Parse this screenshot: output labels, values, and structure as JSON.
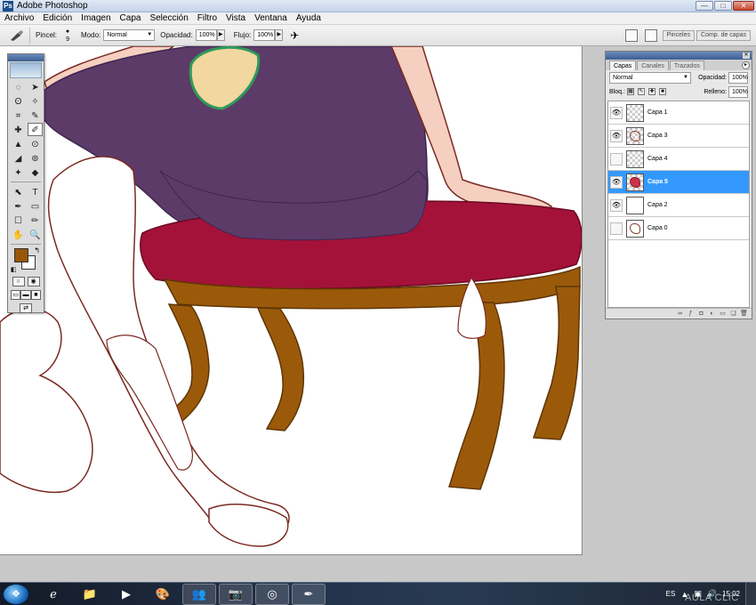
{
  "window": {
    "title": "Adobe Photoshop",
    "app_icon": "Ps"
  },
  "window_controls": {
    "minimize": "—",
    "maximize": "□",
    "close": "✕"
  },
  "menu": [
    "Archivo",
    "Edición",
    "Imagen",
    "Capa",
    "Selección",
    "Filtro",
    "Vista",
    "Ventana",
    "Ayuda"
  ],
  "options": {
    "brush_label": "Pincel:",
    "brush_size": "9",
    "mode_label": "Modo:",
    "mode_value": "Normal",
    "opacity_label": "Opacidad:",
    "opacity_value": "100%",
    "flow_label": "Flujo:",
    "flow_value": "100%",
    "tab_brushes": "Pinceles",
    "tab_comps": "Comp. de capas"
  },
  "toolbox": {
    "tools": [
      "◌",
      "➤",
      "ʘ",
      "✧",
      "⌗",
      "✎",
      "✚",
      "✐",
      "▲",
      "⊙",
      "◢",
      "⊚",
      "✦",
      "◆",
      "⬉",
      "T",
      "✒",
      "▭",
      "☐",
      "✏",
      "✋",
      "🔍"
    ],
    "foreground_color": "#9a5608",
    "background_color": "#ffffff"
  },
  "layers_panel": {
    "tabs": [
      "Capas",
      "Canales",
      "Trazados"
    ],
    "blend_mode": "Normal",
    "opacity_label": "Opacidad:",
    "opacity_value": "100%",
    "lock_label": "Bloq.:",
    "fill_label": "Relleno:",
    "fill_value": "100%",
    "layers": [
      {
        "name": "Capa 1",
        "visible": true,
        "selected": false,
        "thumb": "checker"
      },
      {
        "name": "Capa 3",
        "visible": true,
        "selected": false,
        "thumb": "sketch"
      },
      {
        "name": "Capa 4",
        "visible": false,
        "selected": false,
        "thumb": "checker"
      },
      {
        "name": "Capa 5",
        "visible": true,
        "selected": true,
        "thumb": "color"
      },
      {
        "name": "Capa 2",
        "visible": true,
        "selected": false,
        "thumb": "white"
      },
      {
        "name": "Capa 0",
        "visible": false,
        "selected": false,
        "thumb": "lineart"
      }
    ]
  },
  "taskbar": {
    "language": "ES",
    "time": "15:02",
    "watermark": "AULA CLIC"
  },
  "colors": {
    "dress": "#5c3b68",
    "cushion": "#a4123a",
    "wood": "#9b5a0a",
    "skin": "#f5cfc0",
    "outline": "#7a2a22",
    "selected_layer": "#3399ff"
  }
}
